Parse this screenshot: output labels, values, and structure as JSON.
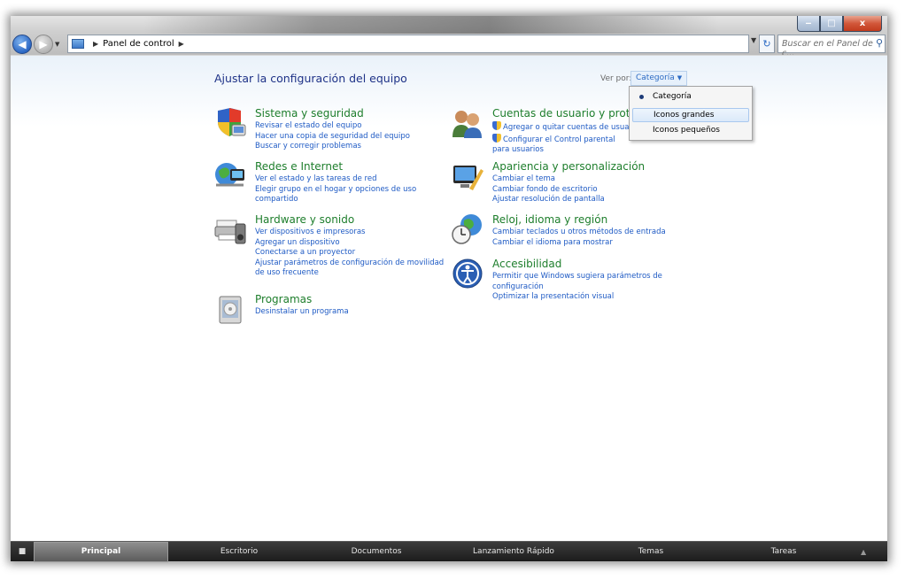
{
  "window": {
    "controls": {
      "minimize": "‒",
      "maximize": "□",
      "close": "x"
    },
    "breadcrumb": [
      "Panel de control"
    ],
    "search_placeholder": "Buscar en el Panel de c...",
    "refresh_glyph": "↻"
  },
  "page": {
    "title": "Ajustar la configuración del equipo",
    "view_by_label": "Ver por:",
    "view_by_value": "Categoría"
  },
  "view_menu": {
    "items": [
      "Categoría",
      "Iconos grandes",
      "Iconos pequeños"
    ],
    "selected": "Categoría",
    "highlighted": "Iconos grandes"
  },
  "categories": [
    {
      "title": "Sistema y seguridad",
      "icon": "shield-computer-icon",
      "links": [
        "Revisar el estado del equipo",
        "Hacer una copia de seguridad del equipo",
        "Buscar y corregir problemas"
      ]
    },
    {
      "title": "Redes e Internet",
      "icon": "network-globe-icon",
      "links": [
        "Ver el estado y las tareas de red",
        "Elegir grupo en el hogar y opciones de uso compartido"
      ]
    },
    {
      "title": "Hardware y sonido",
      "icon": "printer-speaker-icon",
      "links": [
        "Ver dispositivos e impresoras",
        "Agregar un dispositivo",
        "Conectarse a un proyector",
        "Ajustar parámetros de configuración de movilidad de uso frecuente"
      ]
    },
    {
      "title": "Programas",
      "icon": "programs-box-icon",
      "links": [
        "Desinstalar un programa"
      ]
    },
    {
      "title": "Cuentas de usuario y protecc",
      "icon": "users-icon",
      "links": [
        "Agregar o quitar cuentas de usuario",
        "Configurar el Control parental para usuarios"
      ],
      "shielded_links": [
        true,
        true
      ]
    },
    {
      "title": "Apariencia y personalización",
      "icon": "appearance-icon",
      "links": [
        "Cambiar el tema",
        "Cambiar fondo de escritorio",
        "Ajustar resolución de pantalla"
      ]
    },
    {
      "title": "Reloj, idioma y región",
      "icon": "clock-globe-icon",
      "links": [
        "Cambiar teclados u otros métodos de entrada",
        "Cambiar el idioma para mostrar"
      ]
    },
    {
      "title": "Accesibilidad",
      "icon": "accessibility-icon",
      "links": [
        "Permitir que Windows sugiera parámetros de configuración",
        "Optimizar la presentación visual"
      ]
    }
  ],
  "taskbar": {
    "start_glyph": "■",
    "items": [
      "Principal",
      "Escritorio",
      "Documentos",
      "Lanzamiento Rápido",
      "Temas",
      "Tareas"
    ],
    "active": "Principal",
    "tray_glyph": "▲"
  },
  "colors": {
    "category_heading": "#1e7e2c",
    "link": "#1e5ac4",
    "title": "#1e3287"
  }
}
